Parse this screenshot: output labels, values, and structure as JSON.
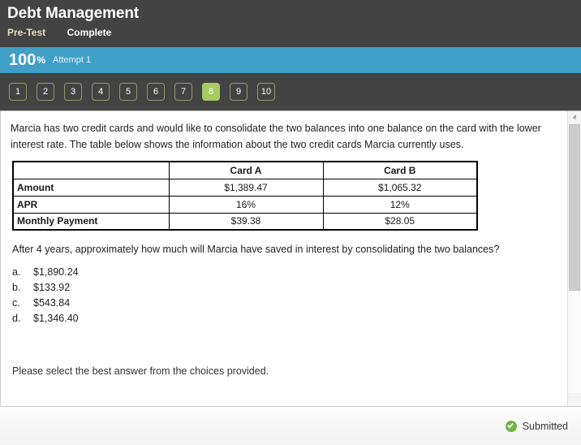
{
  "header": {
    "title": "Debt Management",
    "assessment_type": "Pre-Test",
    "status": "Complete"
  },
  "score_banner": {
    "score": "100",
    "percent_symbol": "%",
    "attempt": "Attempt 1",
    "color": "#3f9fc6"
  },
  "question_nav": {
    "buttons": [
      "1",
      "2",
      "3",
      "4",
      "5",
      "6",
      "7",
      "8",
      "9",
      "10"
    ],
    "active_index": 7,
    "active_color": "#a6cc61"
  },
  "question": {
    "stem": "Marcia has two credit cards and would like to consolidate the two balances into one balance on the card with the lower interest rate. The table below shows the information about the two credit cards Marcia currently uses.",
    "prompt": "After 4 years, approximately how much will Marcia have saved in interest by consolidating the two balances?",
    "instruction": "Please select the best answer from the choices provided."
  },
  "table": {
    "headers": [
      "",
      "Card A",
      "Card B"
    ],
    "rows": [
      {
        "label": "Amount",
        "card_a": "$1,389.47",
        "card_b": "$1,065.32"
      },
      {
        "label": "APR",
        "card_a": "16%",
        "card_b": "12%"
      },
      {
        "label": "Monthly Payment",
        "card_a": "$39.38",
        "card_b": "$28.05"
      }
    ]
  },
  "options": [
    {
      "letter": "a.",
      "text": "$1,890.24"
    },
    {
      "letter": "b.",
      "text": "$133.92"
    },
    {
      "letter": "c.",
      "text": "$543.84"
    },
    {
      "letter": "d.",
      "text": "$1,346.40"
    }
  ],
  "scrollbar": {
    "up_arrow": "ⱏ",
    "down_arrow": "ⱟ"
  },
  "footer": {
    "status_label": "Submitted",
    "status_icon": "check-circle-icon",
    "status_color": "#72b340"
  }
}
